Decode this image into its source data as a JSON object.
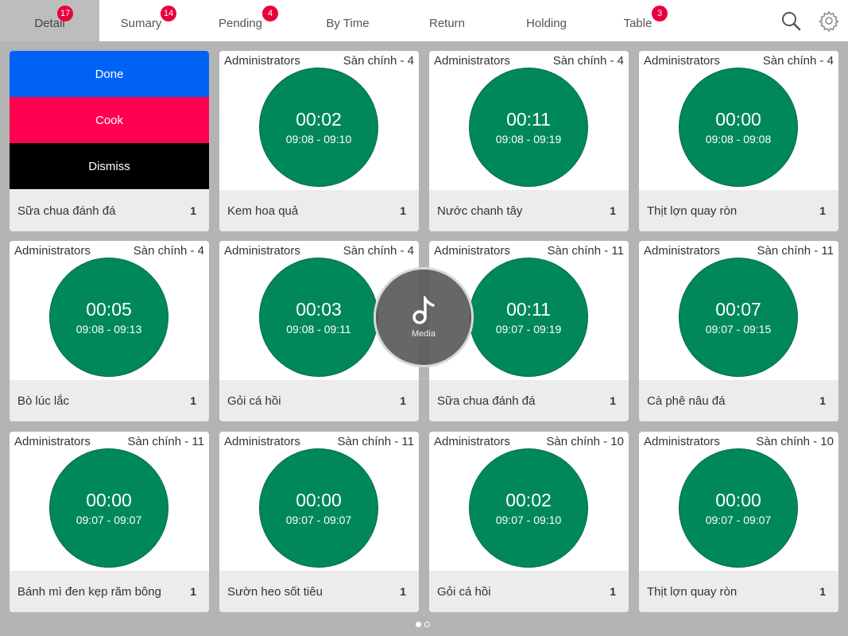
{
  "tabs": [
    {
      "label": "Detail",
      "badge": "17"
    },
    {
      "label": "Sumary",
      "badge": "14"
    },
    {
      "label": "Pending",
      "badge": "4"
    },
    {
      "label": "By Time",
      "badge": ""
    },
    {
      "label": "Return",
      "badge": ""
    },
    {
      "label": "Holding",
      "badge": ""
    },
    {
      "label": "Table",
      "badge": "3"
    }
  ],
  "toolbar": {
    "search_icon": "search-icon",
    "settings_icon": "gear-icon"
  },
  "actions": {
    "done": "Done",
    "cook": "Cook",
    "dismiss": "Dismiss"
  },
  "colors": {
    "done": "#0062f5",
    "cook": "#ff0050",
    "dismiss": "#000000",
    "timer": "#00885a",
    "badge": "#e8003d"
  },
  "action_card": {
    "item": "Sữa chua đánh đá",
    "qty": "1"
  },
  "orders": [
    {
      "user": "Administrators",
      "table": "Sàn chính - 4",
      "time": "00:02",
      "range": "09:08 - 09:10",
      "item": "Kem hoa quả",
      "qty": "1"
    },
    {
      "user": "Administrators",
      "table": "Sàn chính - 4",
      "time": "00:11",
      "range": "09:08 - 09:19",
      "item": "Nước chanh tây",
      "qty": "1"
    },
    {
      "user": "Administrators",
      "table": "Sàn chính - 4",
      "time": "00:00",
      "range": "09:08 - 09:08",
      "item": "Thịt lợn quay ròn",
      "qty": "1"
    },
    {
      "user": "Administrators",
      "table": "Sàn chính - 4",
      "time": "00:05",
      "range": "09:08 - 09:13",
      "item": "Bò lúc lắc",
      "qty": "1"
    },
    {
      "user": "Administrators",
      "table": "Sàn chính - 4",
      "time": "00:03",
      "range": "09:08 - 09:11",
      "item": "Gỏi cá hồi",
      "qty": "1"
    },
    {
      "user": "Administrators",
      "table": "Sàn chính - 11",
      "time": "00:11",
      "range": "09:07 - 09:19",
      "item": "Sữa chua đánh đá",
      "qty": "1"
    },
    {
      "user": "Administrators",
      "table": "Sàn chính - 11",
      "time": "00:07",
      "range": "09:07 - 09:15",
      "item": "Cà phê nâu đá",
      "qty": "1"
    },
    {
      "user": "Administrators",
      "table": "Sàn chính - 11",
      "time": "00:00",
      "range": "09:07 - 09:07",
      "item": "Bánh mì đen kẹp răm bông",
      "qty": "1"
    },
    {
      "user": "Administrators",
      "table": "Sàn chính - 11",
      "time": "00:00",
      "range": "09:07 - 09:07",
      "item": "Sườn heo sốt tiêu",
      "qty": "1"
    },
    {
      "user": "Administrators",
      "table": "Sàn chính - 10",
      "time": "00:02",
      "range": "09:07 - 09:10",
      "item": "Gỏi cá hồi",
      "qty": "1"
    },
    {
      "user": "Administrators",
      "table": "Sàn chính - 10",
      "time": "00:00",
      "range": "09:07 - 09:07",
      "item": "Thịt lợn quay ròn",
      "qty": "1"
    }
  ],
  "media": {
    "label": "Media",
    "icon": "music-note-icon"
  },
  "pager": {
    "current": 1,
    "total": 2
  }
}
